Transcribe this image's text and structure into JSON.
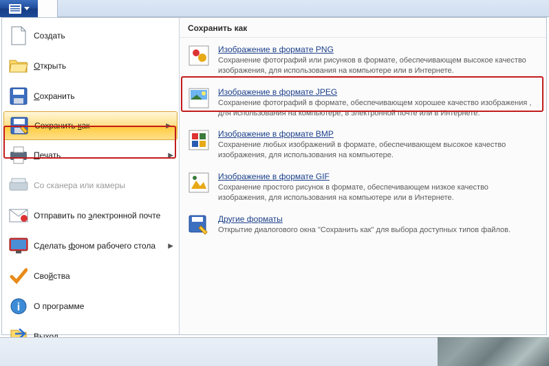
{
  "ribbon": {
    "tab_home": ""
  },
  "menu": {
    "create": "Создать",
    "open": "Открыть",
    "save": "Сохранить",
    "save_as": "Сохранить как",
    "print": "Печать",
    "scanner": "Со сканера или камеры",
    "send_email": "Отправить по электронной почте",
    "set_wallpaper": "Сделать фоном рабочего стола",
    "properties": "Свойства",
    "about": "О программе",
    "exit": "Выход"
  },
  "submenu": {
    "title": "Сохранить как",
    "png": {
      "title": "Изображение в формате PNG",
      "desc": "Сохранение фотографий или рисунков в формате, обеспечивающем высокое качество изображения, для использования на компьютере или в Интернете."
    },
    "jpeg": {
      "title": "Изображение в формате JPEG",
      "desc": "Сохранение фотографий в формате, обеспечивающем хорошее качество изображения , для использования на компьютере, в электронной почте или в Интернете."
    },
    "bmp": {
      "title": "Изображение в формате BMP",
      "desc": "Сохранение любых изображений в формате, обеспечивающем высокое качество изображения, для использования на компьютере."
    },
    "gif": {
      "title": "Изображение в формате GIF",
      "desc": "Сохранение простого рисунок в формате, обеспечивающем низкое качество изображения, для использования на компьютере или в Интернете."
    },
    "other": {
      "title": "Другие форматы",
      "desc": "Открытие диалогового окна \"Сохранить как\" для выбора доступных типов файлов."
    }
  }
}
